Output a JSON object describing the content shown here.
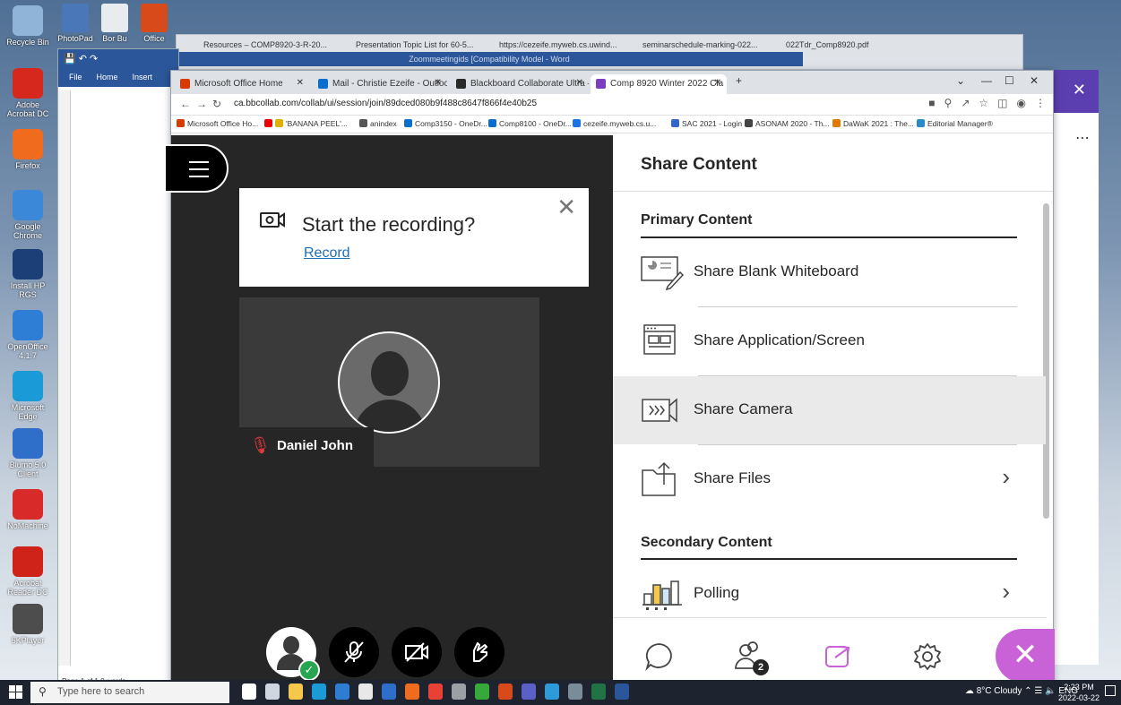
{
  "desktop": {
    "icons": [
      {
        "label": "Recycle Bin",
        "color": "#8fb4d8"
      },
      {
        "label": "Adobe Acrobat DC",
        "color": "#d6281d"
      },
      {
        "label": "Firefox",
        "color": "#f06b1d"
      },
      {
        "label": "Google Chrome",
        "color": "#3b88d9"
      },
      {
        "label": "Install HP RGS",
        "color": "#1c3f77"
      },
      {
        "label": "OpenOffice 4.1.7",
        "color": "#2e7ed6"
      },
      {
        "label": "Microsoft Edge",
        "color": "#1a9ad6"
      },
      {
        "label": "Blumo 5.0 Client",
        "color": "#2f6fc9"
      },
      {
        "label": "NoMachine",
        "color": "#d92a2a"
      },
      {
        "label": "Acrobat Reader DC",
        "color": "#cf2219"
      },
      {
        "label": "5KPlayer",
        "color": "#4d4d4d"
      }
    ],
    "top_icons": [
      {
        "label": "PhotoPad",
        "color": "#4a77b8"
      },
      {
        "label": "Bor Bu",
        "color": "#e9ecef"
      },
      {
        "label": "Office",
        "color": "#d94a1b"
      }
    ]
  },
  "back_browser": {
    "tabs": [
      "Resources – COMP8920-3-R-20...",
      "Presentation Topic List for 60-5...",
      "https://cezeife.myweb.cs.uwind...",
      "seminarschedule-marking-022...",
      "022Tdr_Comp8920.pdf"
    ]
  },
  "word_back": {
    "title": "Zoommeetingids [Compatibility Model - Word",
    "menu_file": "File",
    "menu_home": "Home",
    "menu_insert": "Insert",
    "status": "Page 1 of 1   0 words",
    "partial_left": "Pa"
  },
  "browser": {
    "tabs": [
      {
        "label": "Microsoft Office Home",
        "color": "#d83b01"
      },
      {
        "label": "Mail - Christie Ezeife - Outlook",
        "color": "#0a6ed1"
      },
      {
        "label": "Blackboard Collaborate Ultra – C",
        "color": "#2a2a2a"
      },
      {
        "label": "Comp 8920 Winter 2022 Cla",
        "color": "#7a3fbf"
      }
    ],
    "new_tab": "+",
    "url": "ca.bbcollab.com/collab/ui/session/join/89dced080b9f488c8647f866f4e40b25",
    "bookmarks": [
      {
        "label": "Microsoft Office Ho...",
        "color": "#d83b01"
      },
      {
        "label": "'BANANA PEEL'...",
        "color": "#e0b000"
      },
      {
        "label": "anindex",
        "color": "#555555"
      },
      {
        "label": "Comp3150 - OneDr...",
        "color": "#0a6ed1"
      },
      {
        "label": "Comp8100 - OneDr...",
        "color": "#0a6ed1"
      },
      {
        "label": "cezeife.myweb.cs.u...",
        "color": "#1a73e8"
      },
      {
        "label": "SAC 2021 - Login",
        "color": "#3366cc"
      },
      {
        "label": "ASONAM 2020 - Th...",
        "color": "#444444"
      },
      {
        "label": "DaWaK 2021 : The...",
        "color": "#e07b00"
      },
      {
        "label": "Editorial Manager®",
        "color": "#2c8ac9"
      }
    ]
  },
  "recording": {
    "title": "Start the recording?",
    "link": "Record"
  },
  "participant": {
    "name": "Daniel John"
  },
  "share_panel": {
    "title": "Share Content",
    "primary_heading": "Primary Content",
    "items": [
      {
        "label": "Share Blank Whiteboard"
      },
      {
        "label": "Share Application/Screen"
      },
      {
        "label": "Share Camera"
      },
      {
        "label": "Share Files"
      }
    ],
    "secondary_heading": "Secondary Content",
    "secondary_items": [
      {
        "label": "Polling"
      }
    ],
    "attendee_count": "2"
  },
  "taskbar": {
    "search_placeholder": "Type here to search",
    "weather": "8°C  Cloudy",
    "language": "ENG",
    "time": "2:23 PM",
    "date": "2022-03-22",
    "app_colors": [
      "#ffffff",
      "#cfd6e0",
      "#f5c84b",
      "#1a9ad6",
      "#2d7dd2",
      "#e8e8e8",
      "#2f6fc9",
      "#f06b1d",
      "#e94235",
      "#9aa0a6",
      "#37a83a",
      "#d94a1b",
      "#5b5fc7",
      "#2f9ad8",
      "#7a8b99",
      "#217346",
      "#2b579a"
    ]
  },
  "colors": {
    "accent": "#c862d6",
    "stage_bg": "#262626",
    "link": "#1f6fb5",
    "muted_red": "#e03c3c"
  }
}
